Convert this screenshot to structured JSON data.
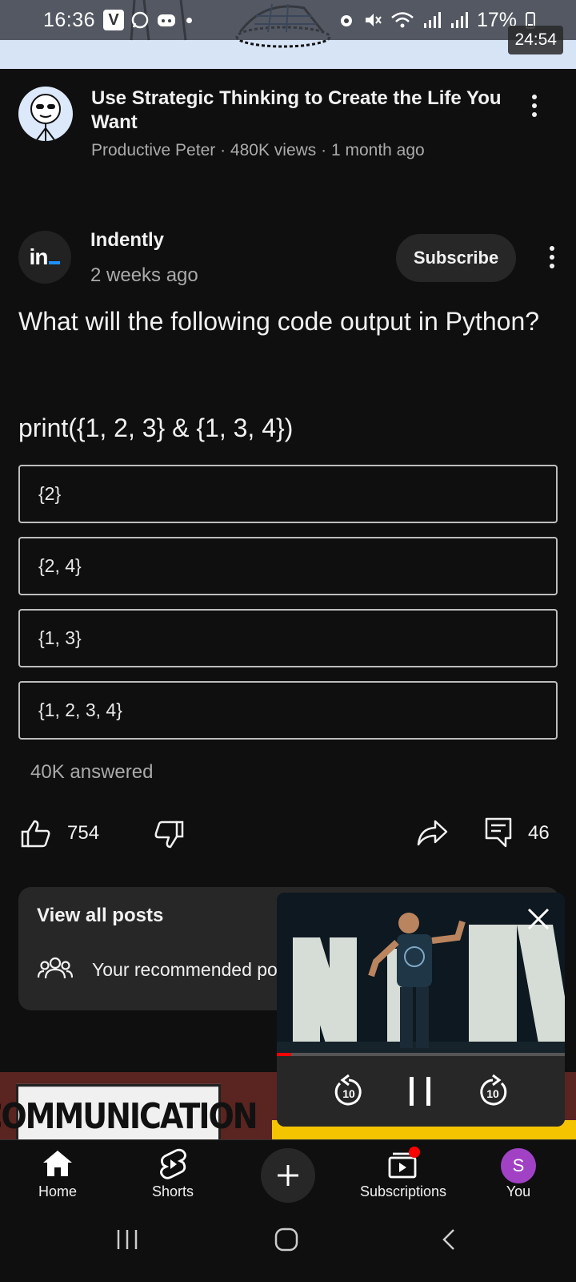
{
  "status_bar": {
    "time": "16:36",
    "battery": "17%",
    "v_badge": "V"
  },
  "top_thumbnail": {
    "duration": "24:54"
  },
  "video_item": {
    "title": "Use Strategic Thinking to Create the Life You Want",
    "meta": "Productive Peter · 480K views · 1 month ago"
  },
  "post": {
    "channel": "Indently",
    "time": "2 weeks ago",
    "subscribe_label": "Subscribe",
    "question": "What will the following code output in Python?",
    "code": "print({1, 2, 3} & {1, 3, 4})",
    "options": [
      "{2}",
      "{2, 4}",
      "{1, 3}",
      "{1, 2, 3, 4}"
    ],
    "answered": "40K answered",
    "likes": "754",
    "comments": "46"
  },
  "posts_card": {
    "title": "View all posts",
    "subtitle": "Your recommended po"
  },
  "banner": {
    "text": "COMMUNICATION"
  },
  "mini_player": {
    "progress": 0.05,
    "rewind_label": "10",
    "forward_label": "10"
  },
  "bottom_nav": {
    "items": [
      {
        "label": "Home"
      },
      {
        "label": "Shorts"
      },
      {
        "label": "Subscriptions"
      },
      {
        "label": "You"
      }
    ],
    "avatar_letter": "S"
  },
  "colors": {
    "background": "#0f0f0f",
    "surface": "#272727",
    "accent_red": "#ff0000",
    "avatar_purple": "#a142c5",
    "brand_blue": "#1e90ff"
  }
}
